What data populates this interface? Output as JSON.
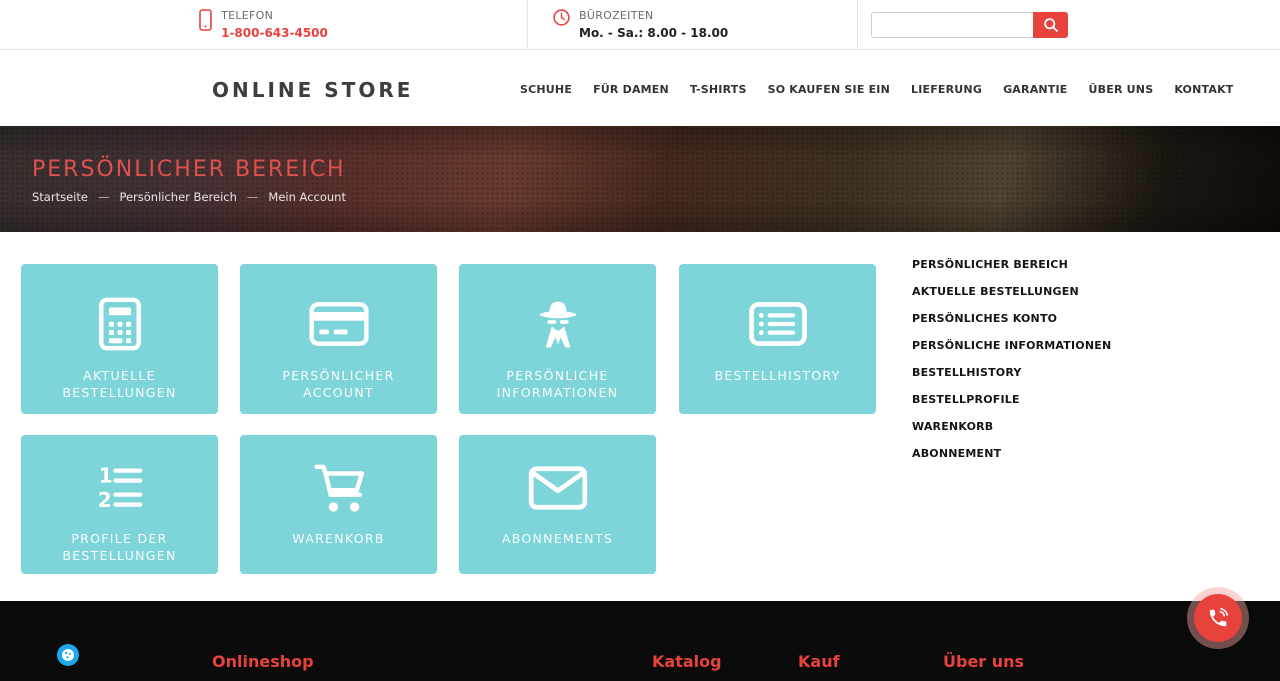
{
  "colors": {
    "accent": "#e8423d",
    "teal": "#7dd4d9",
    "footer_bg": "#0b0b0b",
    "hero_title": "#de5150",
    "cookie_badge_blue": "#1ba8ec"
  },
  "topbar": {
    "phone": {
      "icon": "mobile-phone-icon",
      "label": "TELEFON",
      "value": "1-800-643-4500"
    },
    "hours": {
      "icon": "clock-icon",
      "label": "BÜROZEITEN",
      "value": "Mo. - Sa.: 8.00 - 18.00"
    },
    "search": {
      "icon": "search-icon",
      "value": "",
      "placeholder": ""
    }
  },
  "header": {
    "logo": "ONLINE STORE",
    "nav": [
      "SCHUHE",
      "FÜR DAMEN",
      "T-SHIRTS",
      "SO KAUFEN SIE EIN",
      "LIEFERUNG",
      "GARANTIE",
      "ÜBER UNS",
      "KONTAKT"
    ]
  },
  "hero": {
    "title": "PERSÖNLICHER BEREICH",
    "breadcrumb": [
      "Startseite",
      "Persönlicher Bereich",
      "Mein Account"
    ],
    "separator": "—"
  },
  "tiles": [
    {
      "label": "AKTUELLE BESTELLUNGEN",
      "icon": "calculator-icon"
    },
    {
      "label": "PERSÖNLICHER ACCOUNT",
      "icon": "credit-card-icon"
    },
    {
      "label": "PERSÖNLICHE INFORMATIONEN",
      "icon": "spy-icon"
    },
    {
      "label": "BESTELLHISTORY",
      "icon": "list-icon"
    },
    {
      "label": "PROFILE DER BESTELLUNGEN",
      "icon": "numbered-list-icon"
    },
    {
      "label": "WARENKORB",
      "icon": "cart-icon"
    },
    {
      "label": "ABONNEMENTS",
      "icon": "envelope-icon"
    }
  ],
  "sidebar": {
    "items": [
      "PERSÖNLICHER BEREICH",
      "AKTUELLE BESTELLUNGEN",
      "PERSÖNLICHES KONTO",
      "PERSÖNLICHE INFORMATIONEN",
      "BESTELLHISTORY",
      "BESTELLPROFILE",
      "WARENKORB",
      "ABONNEMENT"
    ]
  },
  "footer": {
    "columns": [
      "Onlineshop",
      "Katalog",
      "Kauf",
      "Über uns"
    ],
    "cookie_icon": "cookie-icon",
    "call_button_icon": "phone-call-icon"
  }
}
